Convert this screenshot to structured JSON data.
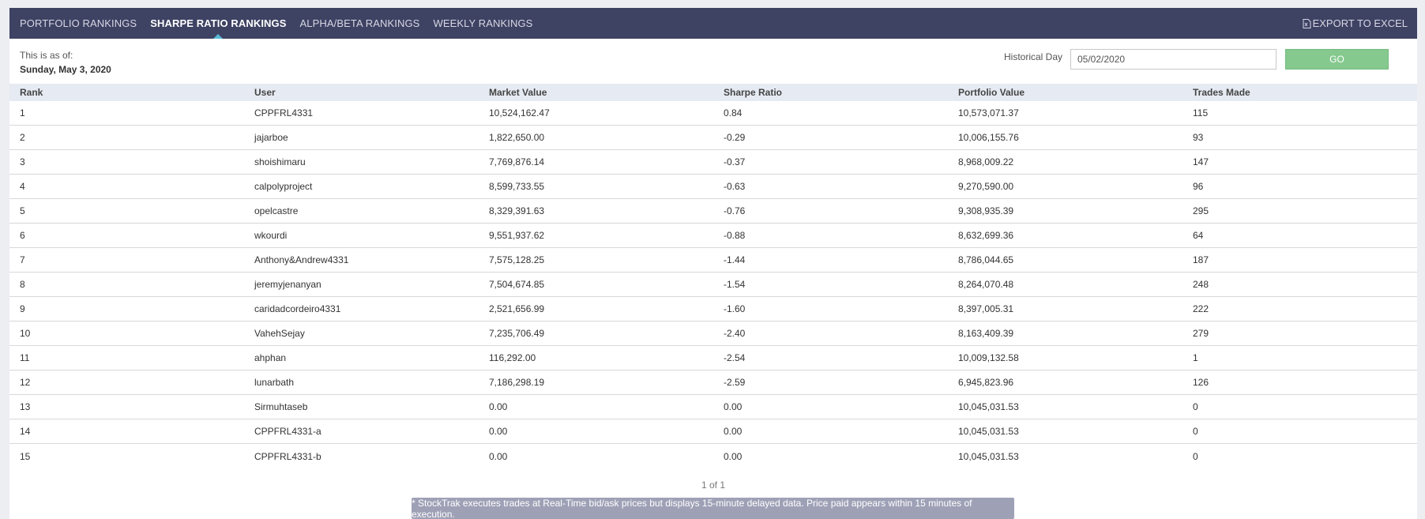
{
  "nav": {
    "tabs": [
      {
        "label": "PORTFOLIO RANKINGS",
        "active": false
      },
      {
        "label": "SHARPE RATIO RANKINGS",
        "active": true
      },
      {
        "label": "ALPHA/BETA RANKINGS",
        "active": false
      },
      {
        "label": "WEEKLY RANKINGS",
        "active": false
      }
    ],
    "export_label": "EXPORT TO EXCEL"
  },
  "asof": {
    "label": "This is as of:",
    "date": "Sunday, May 3, 2020"
  },
  "historical": {
    "label": "Historical Day",
    "value": "05/02/2020",
    "go_label": "GO"
  },
  "table": {
    "headers": [
      "Rank",
      "User",
      "Market Value",
      "Sharpe Ratio",
      "Portfolio Value",
      "Trades Made"
    ],
    "rows": [
      [
        "1",
        "CPPFRL4331",
        "10,524,162.47",
        "0.84",
        "10,573,071.37",
        "115"
      ],
      [
        "2",
        "jajarboe",
        "1,822,650.00",
        "-0.29",
        "10,006,155.76",
        "93"
      ],
      [
        "3",
        "shoishimaru",
        "7,769,876.14",
        "-0.37",
        "8,968,009.22",
        "147"
      ],
      [
        "4",
        "calpolyproject",
        "8,599,733.55",
        "-0.63",
        "9,270,590.00",
        "96"
      ],
      [
        "5",
        "opelcastre",
        "8,329,391.63",
        "-0.76",
        "9,308,935.39",
        "295"
      ],
      [
        "6",
        "wkourdi",
        "9,551,937.62",
        "-0.88",
        "8,632,699.36",
        "64"
      ],
      [
        "7",
        "Anthony&Andrew4331",
        "7,575,128.25",
        "-1.44",
        "8,786,044.65",
        "187"
      ],
      [
        "8",
        "jeremyjenanyan",
        "7,504,674.85",
        "-1.54",
        "8,264,070.48",
        "248"
      ],
      [
        "9",
        "caridadcordeiro4331",
        "2,521,656.99",
        "-1.60",
        "8,397,005.31",
        "222"
      ],
      [
        "10",
        "VahehSejay",
        "7,235,706.49",
        "-2.40",
        "8,163,409.39",
        "279"
      ],
      [
        "11",
        "ahphan",
        "116,292.00",
        "-2.54",
        "10,009,132.58",
        "1"
      ],
      [
        "12",
        "lunarbath",
        "7,186,298.19",
        "-2.59",
        "6,945,823.96",
        "126"
      ],
      [
        "13",
        "Sirmuhtaseb",
        "0.00",
        "0.00",
        "10,045,031.53",
        "0"
      ],
      [
        "14",
        "CPPFRL4331-a",
        "0.00",
        "0.00",
        "10,045,031.53",
        "0"
      ],
      [
        "15",
        "CPPFRL4331-b",
        "0.00",
        "0.00",
        "10,045,031.53",
        "0"
      ]
    ]
  },
  "pager": {
    "text": "1 of 1"
  },
  "notice": {
    "text": "* StockTrak executes trades at Real-Time bid/ask prices but displays 15-minute delayed data. Price paid appears within 15 minutes of execution."
  },
  "colors": {
    "topbar": "#3e4263",
    "active_indicator": "#5ab8d6",
    "go_button": "#85c98e",
    "header_row": "#e6ebf3",
    "notice_bg": "#9ea1b6"
  }
}
